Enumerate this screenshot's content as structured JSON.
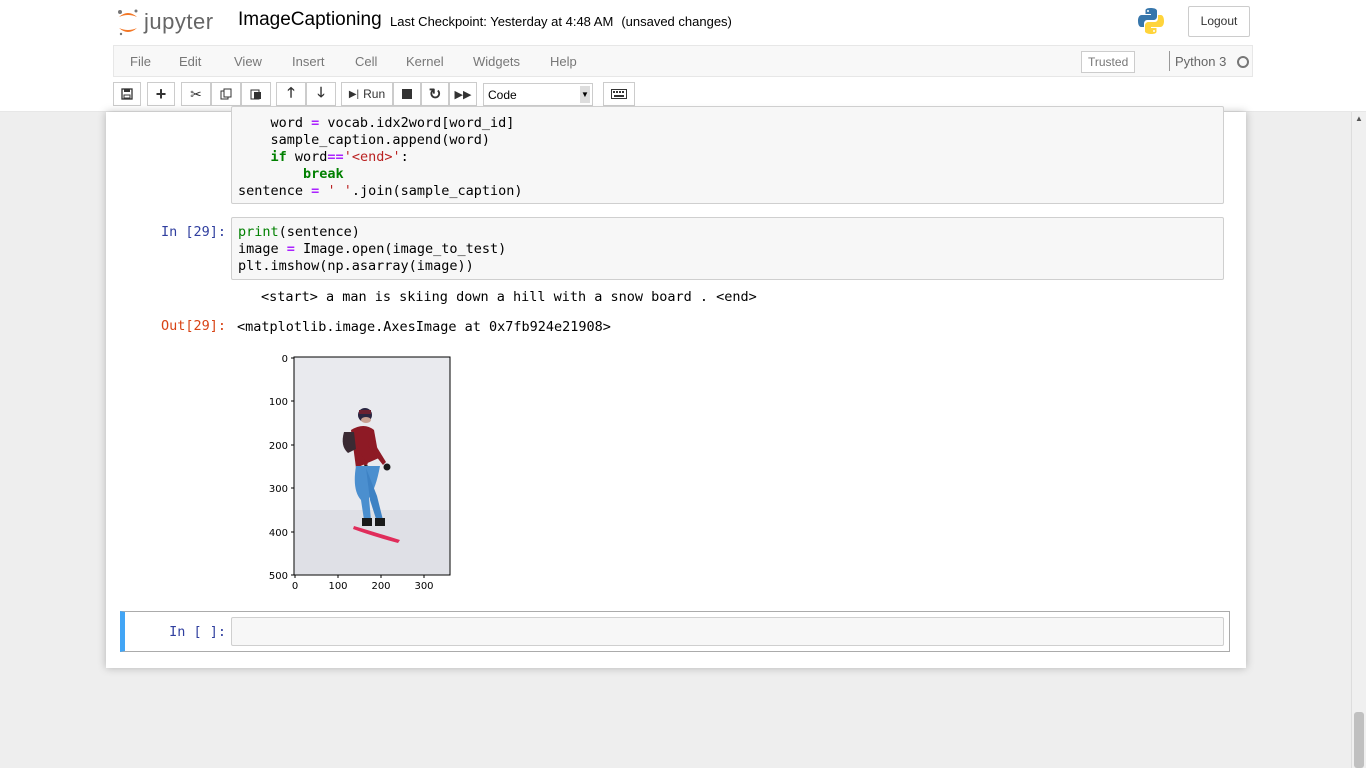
{
  "app": {
    "logo_text": "jupyter",
    "notebook_name": "ImageCaptioning",
    "checkpoint": "Last Checkpoint: Yesterday at 4:48 AM",
    "unsaved": "(unsaved changes)",
    "logout_label": "Logout"
  },
  "menu": {
    "items": [
      "File",
      "Edit",
      "View",
      "Insert",
      "Cell",
      "Kernel",
      "Widgets",
      "Help"
    ],
    "trusted": "Trusted",
    "kernel_name": "Python 3"
  },
  "toolbar": {
    "run_label": "Run",
    "cell_type": "Code"
  },
  "cells": {
    "prev_code": [
      "    word = vocab.idx2word[word_id]",
      "    sample_caption.append(word)",
      "    if word=='<end>':",
      "        break",
      "sentence = ' '.join(sample_caption)"
    ],
    "cell29_prompt": "In [29]:",
    "cell29_code": [
      "print(sentence)",
      "image = Image.open(image_to_test)",
      "plt.imshow(np.asarray(image))"
    ],
    "stdout": "<start> a man is skiing down a hill with a snow board . <end>",
    "out_prompt": "Out[29]:",
    "out_text": "<matplotlib.image.AxesImage at 0x7fb924e21908>",
    "empty_prompt": "In [ ]:"
  },
  "plot": {
    "y_ticks": [
      "0",
      "100",
      "200",
      "300",
      "400",
      "500"
    ],
    "x_ticks": [
      "0",
      "100",
      "200",
      "300"
    ]
  },
  "colors": {
    "prompt_in": "#303f9f",
    "prompt_out": "#d84315",
    "selected_cell": "#42a5f5"
  }
}
